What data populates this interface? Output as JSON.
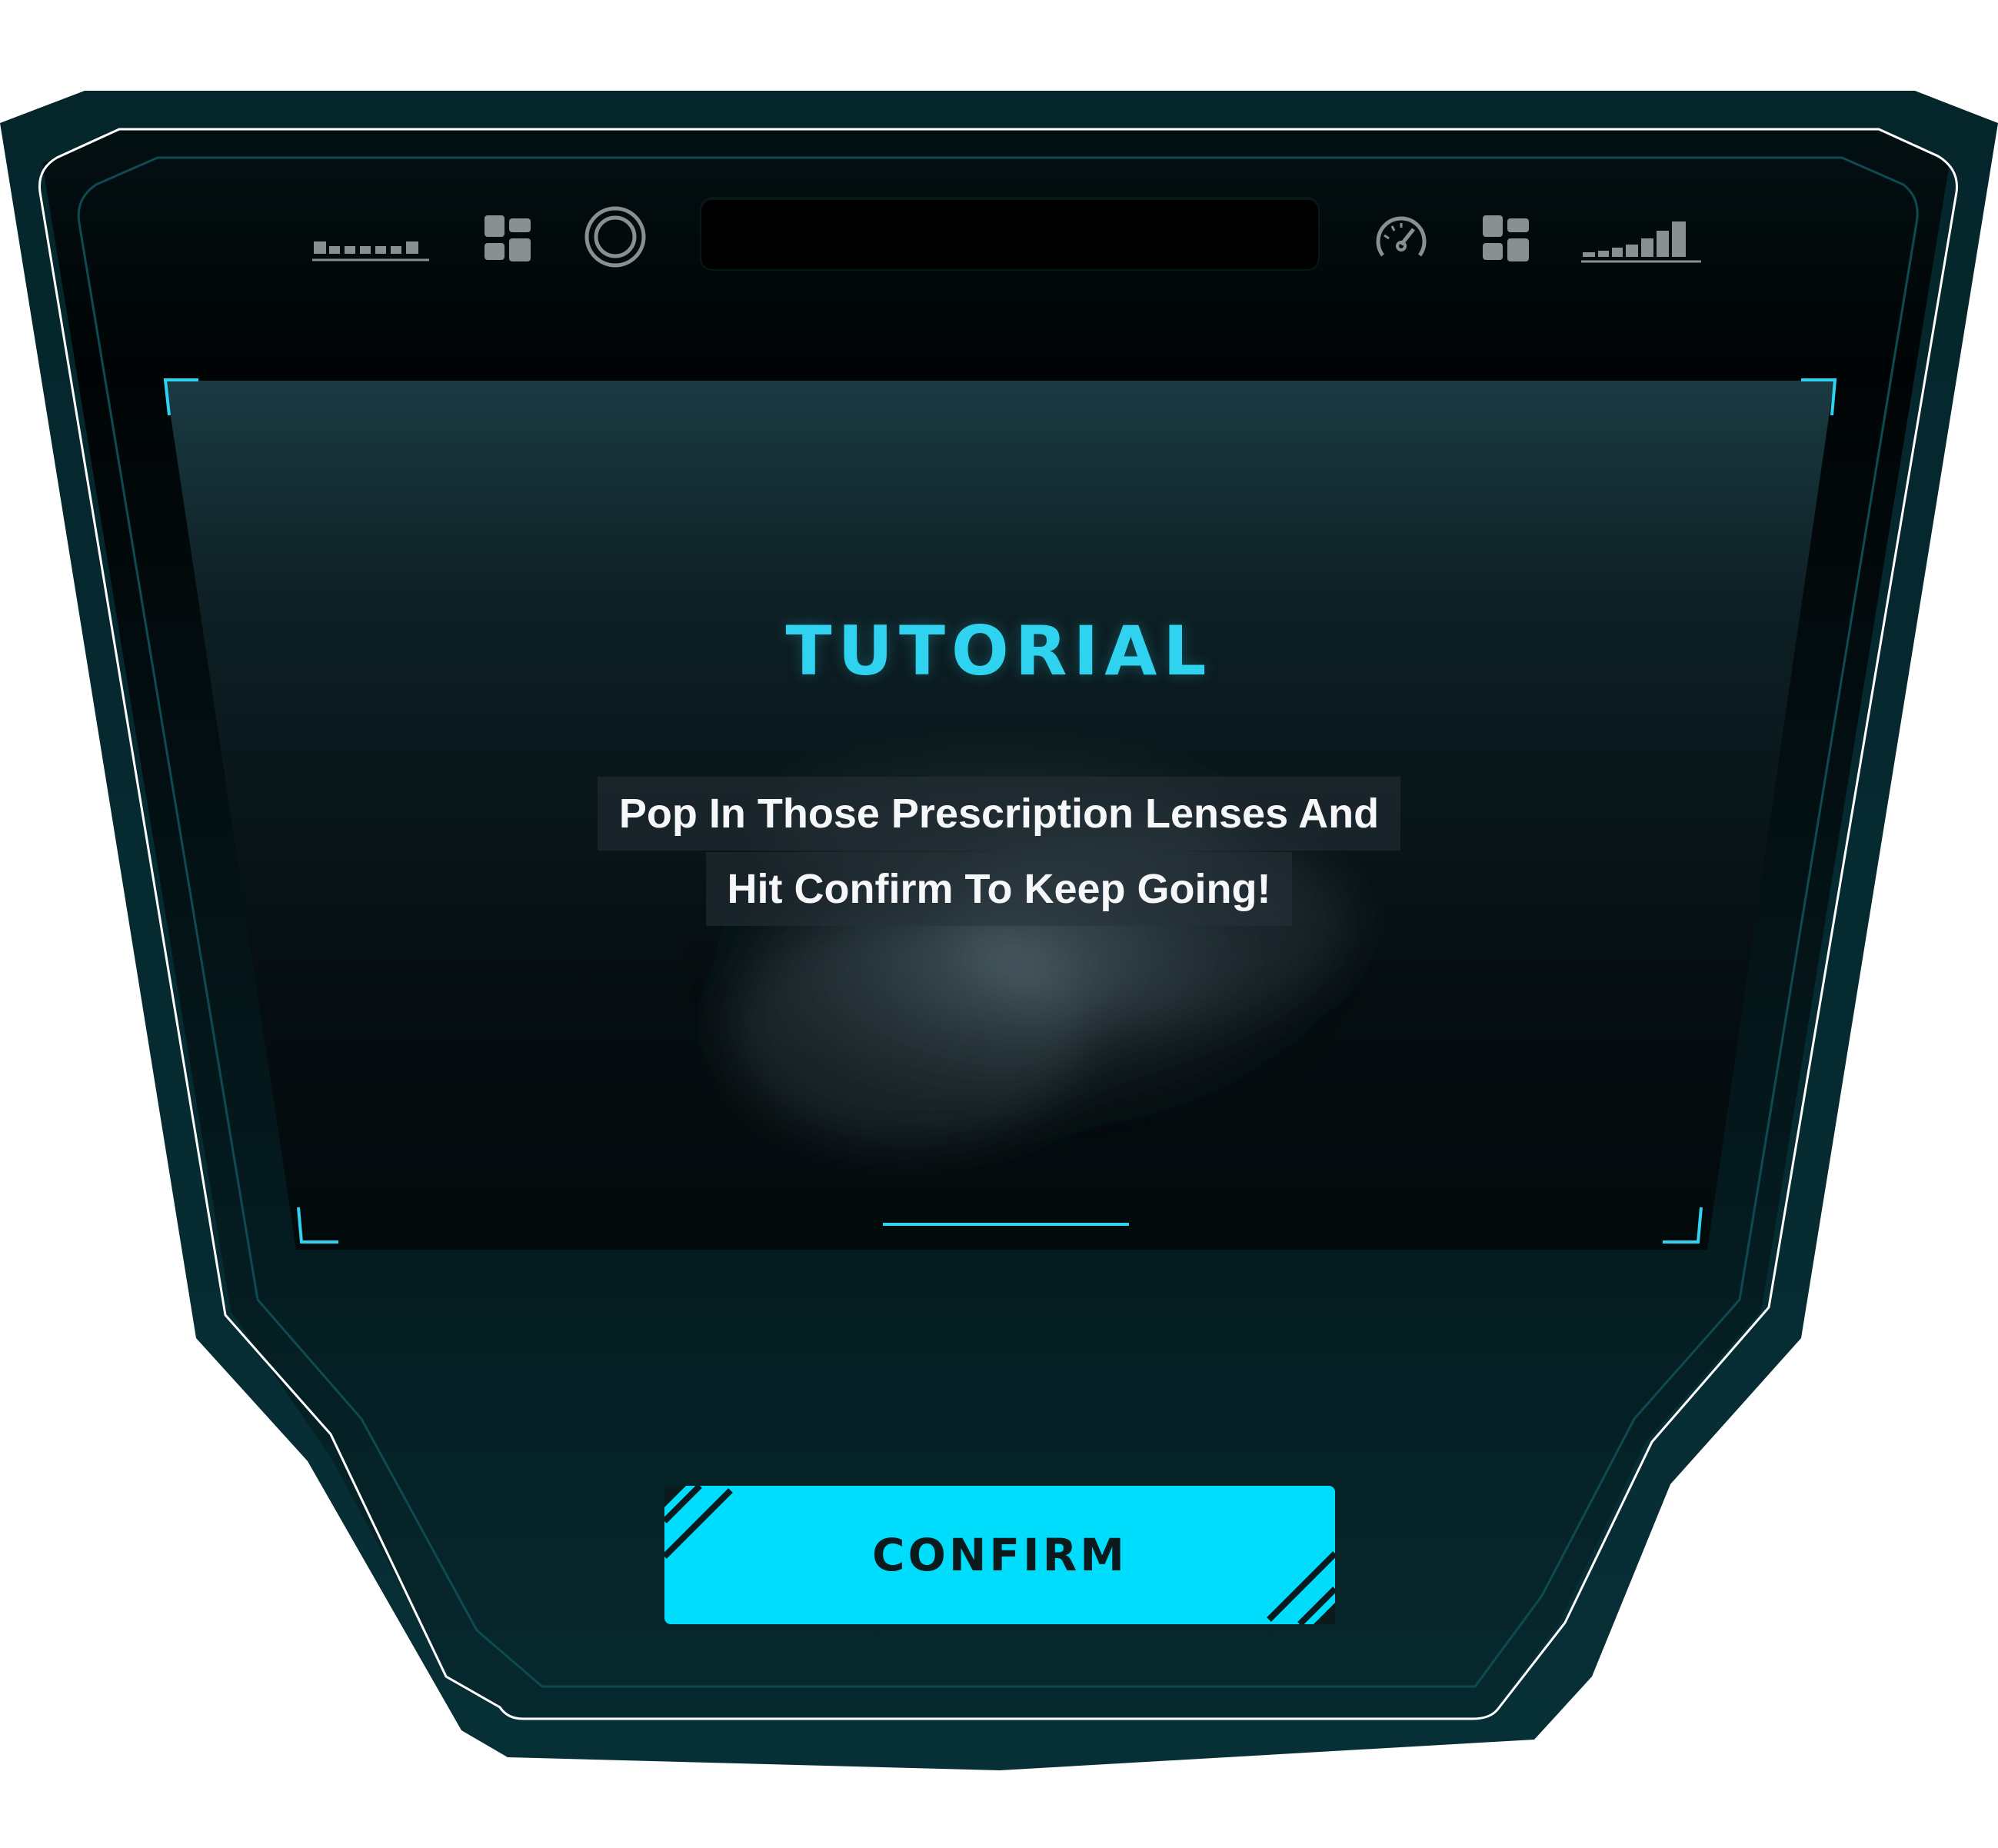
{
  "screen": {
    "title": "TUTORIAL",
    "instruction_lines": [
      "Pop In Those Prescription Lenses And",
      "Hit Confirm To Keep Going!"
    ]
  },
  "actions": {
    "confirm_label": "CONFIRM"
  },
  "status_bar": {
    "left_icons": [
      "battery-segments-icon",
      "grid-apps-icon",
      "ring-icon"
    ],
    "right_icons": [
      "speedometer-icon",
      "grid-apps-icon",
      "signal-bars-icon"
    ]
  },
  "theme": {
    "accent": "#2fd3ef",
    "button": "#00dcfb",
    "frame_outer": "#073036",
    "frame_line": "#ffffff"
  }
}
